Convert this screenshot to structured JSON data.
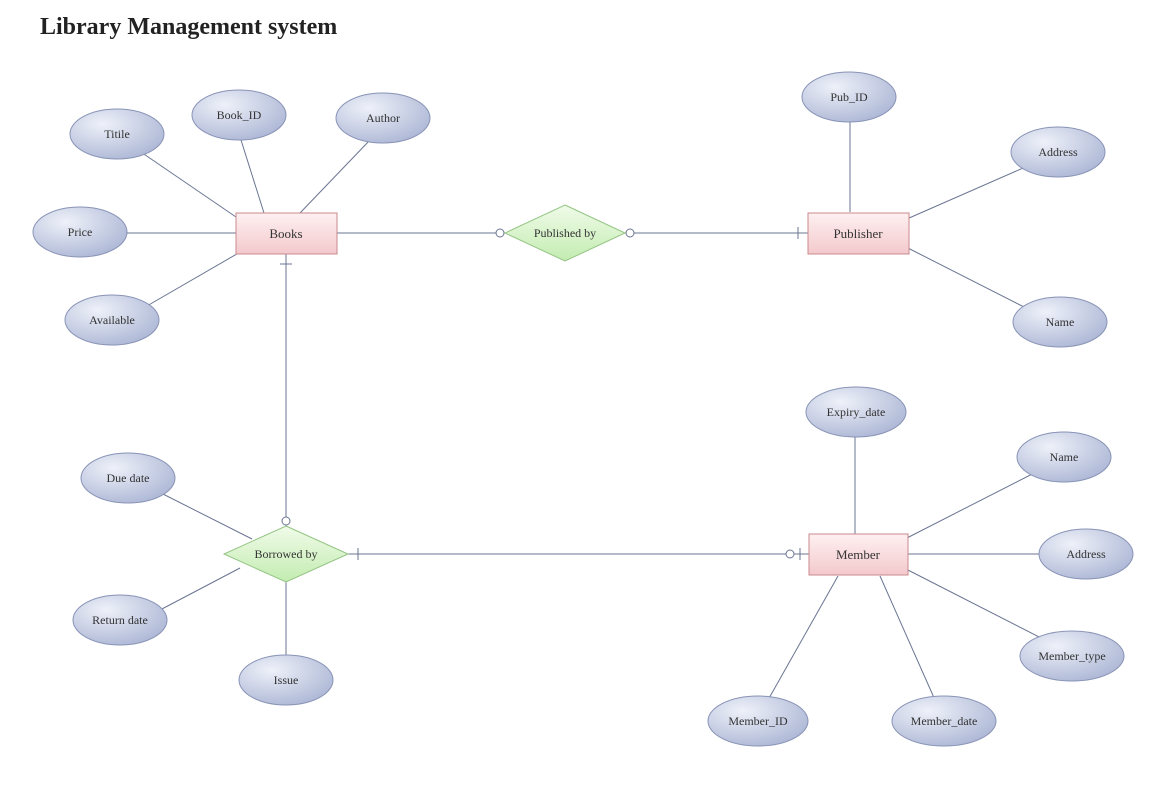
{
  "title": "Library Management system",
  "entities": {
    "books": "Books",
    "publisher": "Publisher",
    "member": "Member"
  },
  "relationships": {
    "published_by": "Published by",
    "borrowed_by": "Borrowed by"
  },
  "attributes": {
    "books": {
      "title": "Titile",
      "book_id": "Book_ID",
      "author": "Author",
      "price": "Price",
      "available": "Available"
    },
    "publisher": {
      "pub_id": "Pub_ID",
      "address": "Address",
      "name": "Name"
    },
    "member": {
      "expiry_date": "Expiry_date",
      "name": "Name",
      "address": "Address",
      "member_type": "Member_type",
      "member_date": "Member_date",
      "member_id": "Member_ID"
    },
    "borrowed_by": {
      "due_date": "Due date",
      "return_date": "Return date",
      "issue": "Issue"
    }
  },
  "colors": {
    "entity_fill_top": "#fdeaeb",
    "entity_fill_bot": "#f6c7c9",
    "entity_stroke": "#c98a8d",
    "attr_fill_top": "#e8ecf6",
    "attr_fill_bot": "#b7c0dc",
    "attr_stroke": "#8893b6",
    "rel_fill_top": "#eaf9e2",
    "rel_fill_bot": "#c6edb5",
    "rel_stroke": "#93c483",
    "line": "#6a7592"
  }
}
